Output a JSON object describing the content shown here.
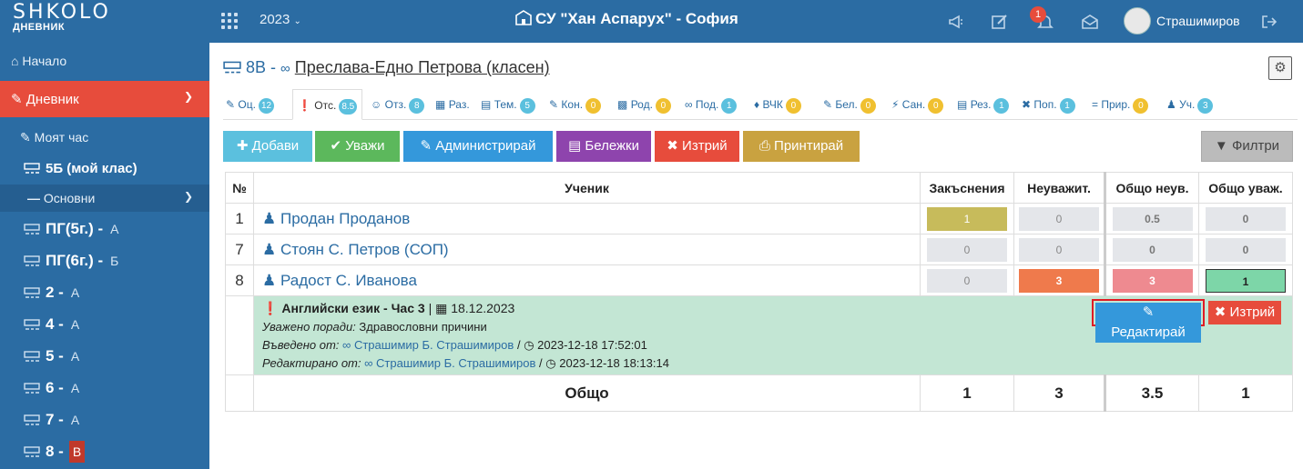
{
  "header": {
    "logo_main": "SHKOLO",
    "logo_sub": "ДНЕВНИК",
    "year": "2023",
    "school": "СУ \"Хан Аспарух\" - София",
    "notifications_count": "1",
    "user_name": "Страшимиров"
  },
  "sidebar": {
    "home": "Начало",
    "diary": "Дневник",
    "my_hour": "Моят час",
    "my_class": "5Б (мой клас)",
    "basic": "Основни",
    "classes": [
      {
        "grade": "ПГ(5г.) -",
        "letter": "А"
      },
      {
        "grade": "ПГ(6г.) -",
        "letter": "Б"
      },
      {
        "grade": "2 -",
        "letter": "А"
      },
      {
        "grade": "4 -",
        "letter": "А"
      },
      {
        "grade": "5 -",
        "letter": "А"
      },
      {
        "grade": "6 -",
        "letter": "А"
      },
      {
        "grade": "7 -",
        "letter": "А"
      },
      {
        "grade": "8 -",
        "letter": "В"
      }
    ]
  },
  "page": {
    "class_name": "8В -",
    "teacher": "Преслава-Едно Петрова (класен)"
  },
  "tabs": [
    {
      "label": "Оц.",
      "count": "12",
      "color": "#5bc0de"
    },
    {
      "label": "Отс.",
      "count": "8.5",
      "color": "#5bc0de"
    },
    {
      "label": "Отз.",
      "count": "8",
      "color": "#5bc0de"
    },
    {
      "label": "Раз.",
      "count": "",
      "color": ""
    },
    {
      "label": "Тем.",
      "count": "5",
      "color": "#5bc0de"
    },
    {
      "label": "Кон.",
      "count": "0",
      "color": "#f0c030"
    },
    {
      "label": "Род.",
      "count": "0",
      "color": "#f0c030"
    },
    {
      "label": "Под.",
      "count": "1",
      "color": "#5bc0de"
    },
    {
      "label": "ВЧК",
      "count": "0",
      "color": "#f0c030"
    },
    {
      "label": "Бел.",
      "count": "0",
      "color": "#f0c030"
    },
    {
      "label": "Сан.",
      "count": "0",
      "color": "#f0c030"
    },
    {
      "label": "Рез.",
      "count": "1",
      "color": "#5bc0de"
    },
    {
      "label": "Поп.",
      "count": "1",
      "color": "#5bc0de"
    },
    {
      "label": "Прир.",
      "count": "0",
      "color": "#f0c030"
    },
    {
      "label": "Уч.",
      "count": "3",
      "color": "#5bc0de"
    }
  ],
  "toolbar": {
    "add": "Добави",
    "excuse": "Уважи",
    "admin": "Администрирай",
    "notes": "Бележки",
    "delete": "Изтрий",
    "print": "Принтирай",
    "filters": "Филтри"
  },
  "table": {
    "headers": [
      "№",
      "Ученик",
      "Закъснения",
      "Неуважит.",
      "Общо неув.",
      "Общо уваж."
    ],
    "rows": [
      {
        "no": "1",
        "name": "Продан Проданов",
        "late": "1",
        "unexcused": "0",
        "total_unexc": "0.5",
        "total_exc": "0"
      },
      {
        "no": "7",
        "name": "Стоян С. Петров (СОП)",
        "late": "0",
        "unexcused": "0",
        "total_unexc": "0",
        "total_exc": "0"
      },
      {
        "no": "8",
        "name": "Радост С. Иванова",
        "late": "0",
        "unexcused": "3",
        "total_unexc": "3",
        "total_exc": "1"
      }
    ],
    "detail": {
      "subject": "Английски език - Час 3",
      "sep": "|",
      "date": "18.12.2023",
      "reason_label": "Уважено поради:",
      "reason": "Здравословни причини",
      "entered_label": "Въведено от:",
      "entered_by": "Страшимир Б. Страшимиров",
      "entered_at": "2023-12-18 17:52:01",
      "edited_label": "Редактирано от:",
      "edited_by": "Страшимир Б. Страшимиров",
      "edited_at": "2023-12-18 18:13:14",
      "slash": "/",
      "edit_button": "Редактирай",
      "delete_button": "Изтрий"
    },
    "totals": {
      "label": "Общо",
      "late": "1",
      "unexcused": "3",
      "total_unexc": "3.5",
      "total_exc": "1"
    }
  }
}
